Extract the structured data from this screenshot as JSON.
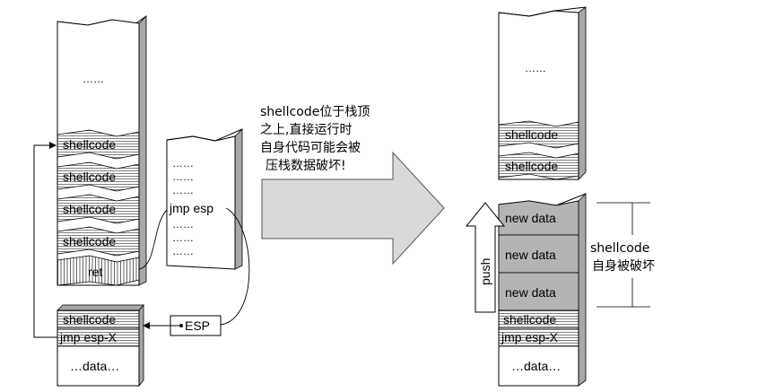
{
  "left_stack": {
    "top_dots": "……",
    "shellcode_cells": [
      "shellcode",
      "shellcode",
      "shellcode",
      "shellcode"
    ],
    "ret_label": "ret",
    "bottom_shellcode": "shellcode",
    "bottom_jmp": "jmp esp-X",
    "bottom_data": "…data…"
  },
  "code_column": {
    "dots_top": [
      "……",
      "……",
      "……"
    ],
    "jmp_label": "jmp esp",
    "dots_bottom": [
      "……",
      "……",
      "……",
      "……"
    ]
  },
  "esp_box": {
    "label": "ESP"
  },
  "arrow_note": {
    "lines": [
      "shellcode位于栈顶",
      "之上,直接运行时",
      "自身代码可能会被",
      "压栈数据破坏!"
    ]
  },
  "right_stack": {
    "top_dots": "……",
    "shellcode_cells": [
      "shellcode",
      "shellcode"
    ],
    "new_data_cells": [
      "new data",
      "new data",
      "new data"
    ],
    "bottom_shellcode": "shellcode",
    "bottom_jmp": "jmp esp-X",
    "bottom_data": "…data…"
  },
  "push_label": "push",
  "bracket_label": {
    "line1": "shellcode",
    "line2": "自身被破坏"
  },
  "colors": {
    "shade": "#a8a8a8",
    "new_data_fill": "#b4b4b4",
    "arrow_fill": "#d9d9d9",
    "outline": "#000000"
  }
}
